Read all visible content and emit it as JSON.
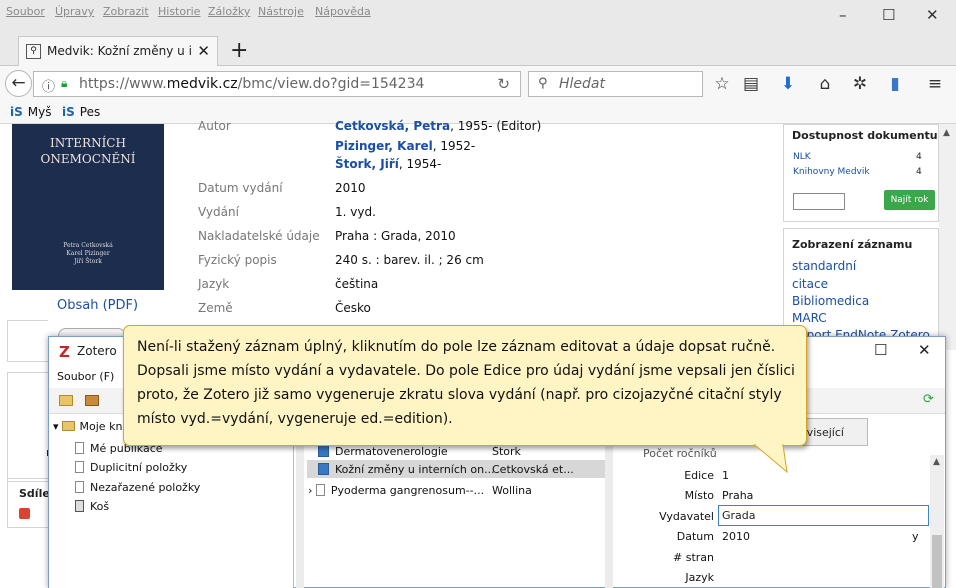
{
  "menu": [
    "Soubor",
    "Úpravy",
    "Zobrazit",
    "Historie",
    "Záložky",
    "Nástroje",
    "Nápověda"
  ],
  "window_controls": {
    "minimize": "–",
    "maximize": "☐",
    "close": "✕"
  },
  "tab": {
    "title": "Medvik: Kožní změny u inter",
    "close": "✕",
    "new_tab": "+"
  },
  "urlbar": {
    "url_prefix": "https://www.",
    "url_host": "medvik.cz",
    "url_path": "/bmc/view.do?gid=154234",
    "search_placeholder": "Hledat"
  },
  "bookmarks": [
    {
      "label": "Myš"
    },
    {
      "label": "Pes"
    }
  ],
  "book": {
    "title_line1": "INTERNÍCH",
    "title_line2": "ONEMOCNĚNÍ",
    "authors": "Petra Cetkovská\nKarel Pizinger\nJiří Štork"
  },
  "obsah_link": "Obsah (PDF)",
  "record": {
    "author_label": "Autor",
    "authors": [
      {
        "name": "Cetkovská, Petra",
        "suffix": ", 1955- (Editor)"
      },
      {
        "name": "Pizinger, Karel",
        "suffix": ", 1952-"
      },
      {
        "name": "Štork, Jiří",
        "suffix": ", 1954-"
      }
    ],
    "fields": [
      {
        "label": "Datum vydání",
        "value": "2010"
      },
      {
        "label": "Vydání",
        "value": "1. vyd."
      },
      {
        "label": "Nakladatelské údaje",
        "value": "Praha : Grada, 2010"
      },
      {
        "label": "Fyzický popis",
        "value": "240 s. : barev. il. ; 26 cm"
      },
      {
        "label": "Jazyk",
        "value": "čeština"
      },
      {
        "label": "Země",
        "value": "Česko"
      }
    ]
  },
  "availability": {
    "title": "Dostupnost dokumentu",
    "rows": [
      {
        "name": "NLK",
        "count": "4"
      },
      {
        "name": "Knihovny Medvik",
        "count": "4"
      }
    ],
    "button": "Najít rok"
  },
  "display": {
    "title": "Zobrazení záznamu",
    "links": [
      "standardní",
      "citace",
      "Bibliomedica",
      "MARC",
      "Export EndNote,Zotero"
    ]
  },
  "left_partial": {
    "share": "Sdílet",
    "ne": "n"
  },
  "zotero": {
    "title": "Zotero",
    "menu_first": "Soubor (F)",
    "collections": [
      "Moje knihovna",
      "Mé publikace",
      "Duplicitní položky",
      "Nezařazené položky",
      "Koš"
    ],
    "items": [
      {
        "title": "Dermatovenerologie",
        "creator": "Štork"
      },
      {
        "title": "Kožní změny u interních on...",
        "creator": "Cetkovská et..."
      },
      {
        "title": "Pyoderma gangrenosum--...",
        "creator": "Wollina"
      }
    ],
    "related_tab": "Související",
    "fields_partial": "Počet ročníků",
    "edit_fields": [
      {
        "label": "Edice",
        "value": "1"
      },
      {
        "label": "Místo",
        "value": "Praha"
      },
      {
        "label": "Vydavatel",
        "value": "Grada"
      },
      {
        "label": "Datum",
        "value": "2010"
      },
      {
        "label": "# stran",
        "value": ""
      },
      {
        "label": "Jazyk",
        "value": ""
      }
    ],
    "date_suffix": "y"
  },
  "tooltip": "Není-li stažený záznam úplný, kliknutím do pole lze záznam editovat a údaje dopsat ručně. Dopsali jsme místo vydání a vydavatele. Do pole Edice pro údaj vydání jsme vepsali jen číslici proto, že Zotero již samo vygeneruje zkratu slova vydání (např. pro cizojazyčné citační styly místo vyd.=vydání, vygeneruje ed.=edition).",
  "colors": {
    "link": "#1a4fa3",
    "tooltip_bg": "#fff5c4",
    "tooltip_border": "#d5a520",
    "book_cover": "#1d2d4d",
    "green_button": "#3ca64a"
  }
}
